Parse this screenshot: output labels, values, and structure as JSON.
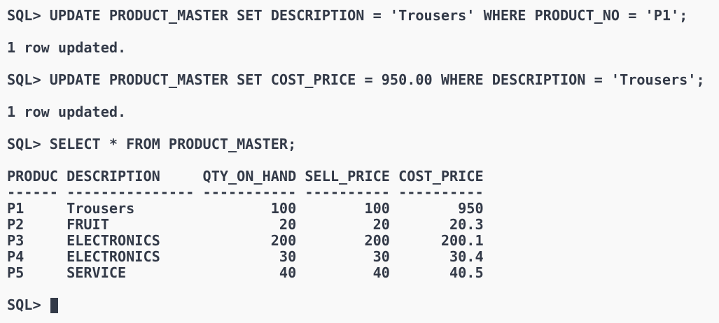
{
  "terminal": {
    "lines": [
      "SQL> UPDATE PRODUCT_MASTER SET DESCRIPTION = 'Trousers' WHERE PRODUCT_NO = 'P1';",
      "1 row updated.",
      "SQL> UPDATE PRODUCT_MASTER SET COST_PRICE = 950.00 WHERE DESCRIPTION = 'Trousers';",
      "1 row updated.",
      "SQL> SELECT * FROM PRODUCT_MASTER;",
      "PRODUC DESCRIPTION     QTY_ON_HAND SELL_PRICE COST_PRICE",
      "------ --------------- ----------- ---------- ----------",
      "P1     Trousers                100        100        950",
      "P2     FRUIT                    20         20       20.3",
      "P3     ELECTRONICS             200        200      200.1",
      "P4     ELECTRONICS              30         30       30.4",
      "P5     SERVICE                  40         40       40.5",
      "SQL> "
    ]
  }
}
